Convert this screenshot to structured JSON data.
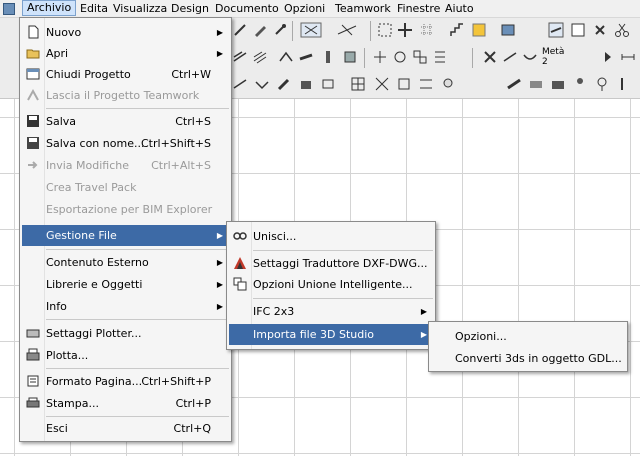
{
  "menubar": {
    "items": [
      "Archivio",
      "Edita",
      "Visualizza",
      "Design",
      "Documento",
      "Opzioni",
      "Teamwork",
      "Finestre",
      "Aiuto"
    ]
  },
  "toolbar": {
    "meta_label": "Metà",
    "meta_value": "2"
  },
  "archivio_menu": {
    "items": [
      {
        "label": "Nuovo",
        "shortcut": "",
        "submenu": true
      },
      {
        "label": "Apri",
        "shortcut": "",
        "submenu": true
      },
      {
        "label": "Chiudi Progetto",
        "shortcut": "Ctrl+W",
        "submenu": false
      },
      {
        "label": "Lascia il Progetto Teamwork",
        "shortcut": "",
        "submenu": false
      },
      {
        "label": "Salva",
        "shortcut": "Ctrl+S",
        "submenu": false
      },
      {
        "label": "Salva con nome...",
        "shortcut": "Ctrl+Shift+S",
        "submenu": false
      },
      {
        "label": "Invia Modifiche",
        "shortcut": "Ctrl+Alt+S",
        "submenu": false
      },
      {
        "label": "Crea Travel Pack",
        "shortcut": "",
        "submenu": false
      },
      {
        "label": "Esportazione per BIM Explorer",
        "shortcut": "",
        "submenu": false
      },
      {
        "label": "Gestione File",
        "shortcut": "",
        "submenu": true
      },
      {
        "label": "Contenuto Esterno",
        "shortcut": "",
        "submenu": true
      },
      {
        "label": "Librerie e Oggetti",
        "shortcut": "",
        "submenu": true
      },
      {
        "label": "Info",
        "shortcut": "",
        "submenu": true
      },
      {
        "label": "Settaggi Plotter...",
        "shortcut": "",
        "submenu": false
      },
      {
        "label": "Plotta...",
        "shortcut": "",
        "submenu": false
      },
      {
        "label": "Formato Pagina...",
        "shortcut": "Ctrl+Shift+P",
        "submenu": false
      },
      {
        "label": "Stampa...",
        "shortcut": "Ctrl+P",
        "submenu": false
      },
      {
        "label": "Esci",
        "shortcut": "Ctrl+Q",
        "submenu": false
      }
    ]
  },
  "gestione_menu": {
    "items": [
      {
        "label": "Unisci..."
      },
      {
        "label": "Settaggi Traduttore DXF-DWG..."
      },
      {
        "label": "Opzioni Unione Intelligente..."
      },
      {
        "label": "IFC 2x3"
      },
      {
        "label": "Importa file 3D Studio"
      }
    ]
  },
  "studio_menu": {
    "items": [
      {
        "label": "Opzioni..."
      },
      {
        "label": "Converti 3ds in oggetto GDL..."
      }
    ]
  }
}
